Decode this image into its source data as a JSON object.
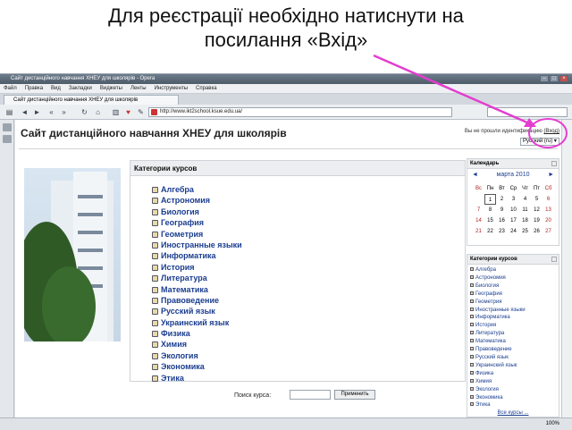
{
  "slide": {
    "title_line1": "Для реєстрації необхідно натиснути на",
    "title_line2": "посилання «Вхід»"
  },
  "browser": {
    "window_title": "Сайт дистанційного навчання ХНЕУ для школярів - Opera",
    "menu": [
      "Файл",
      "Правка",
      "Вид",
      "Закладки",
      "Виджеты",
      "Ленты",
      "Инструменты",
      "Справка"
    ],
    "tab_title": "Сайт дистанційного навчання ХНЕУ для школярів",
    "address": "http://www.ikt2school.ksue.edu.ua/",
    "zoom": "100%"
  },
  "site": {
    "title": "Сайт дистанційного навчання ХНЕУ для школярів",
    "login_text": "Вы не прошли идентификацию",
    "login_link": "(Вход)",
    "language": "Русский (ru)"
  },
  "main_categories": {
    "heading": "Категории курсов",
    "items": [
      "Алгебра",
      "Астрономия",
      "Биология",
      "География",
      "Геометрия",
      "Иностранные языки",
      "Информатика",
      "История",
      "Литература",
      "Математика",
      "Правоведение",
      "Русский язык",
      "Украинский язык",
      "Физика",
      "Химия",
      "Экология",
      "Экономика",
      "Этика"
    ]
  },
  "course_search": {
    "label": "Поиск курса:",
    "button": "Применить"
  },
  "calendar": {
    "heading": "Календарь",
    "month": "марта 2010",
    "prev": "◄",
    "next": "►",
    "weekdays": [
      "Вс",
      "Пн",
      "Вт",
      "Ср",
      "Чт",
      "Пт",
      "Сб"
    ],
    "cells": [
      "",
      "1",
      "2",
      "3",
      "4",
      "5",
      "6",
      "7",
      "8",
      "9",
      "10",
      "11",
      "12",
      "13",
      "14",
      "15",
      "16",
      "17",
      "18",
      "19",
      "20",
      "21",
      "22",
      "23",
      "24",
      "25",
      "26",
      "27"
    ],
    "today": "1",
    "weekend_color": "#b22222"
  },
  "side_categories": {
    "heading": "Категории курсов",
    "items": [
      "Алгебра",
      "Астрономия",
      "Биология",
      "География",
      "Геометрия",
      "Иностранные языки",
      "Информатика",
      "История",
      "Литература",
      "Математика",
      "Правоведение",
      "Русский язык",
      "Украинский язык",
      "Физика",
      "Химия",
      "Экология",
      "Экономика",
      "Этика"
    ],
    "all_link": "Все курсы ..."
  },
  "colors": {
    "link": "#1a3d8f",
    "highlight": "#e33dd0"
  }
}
